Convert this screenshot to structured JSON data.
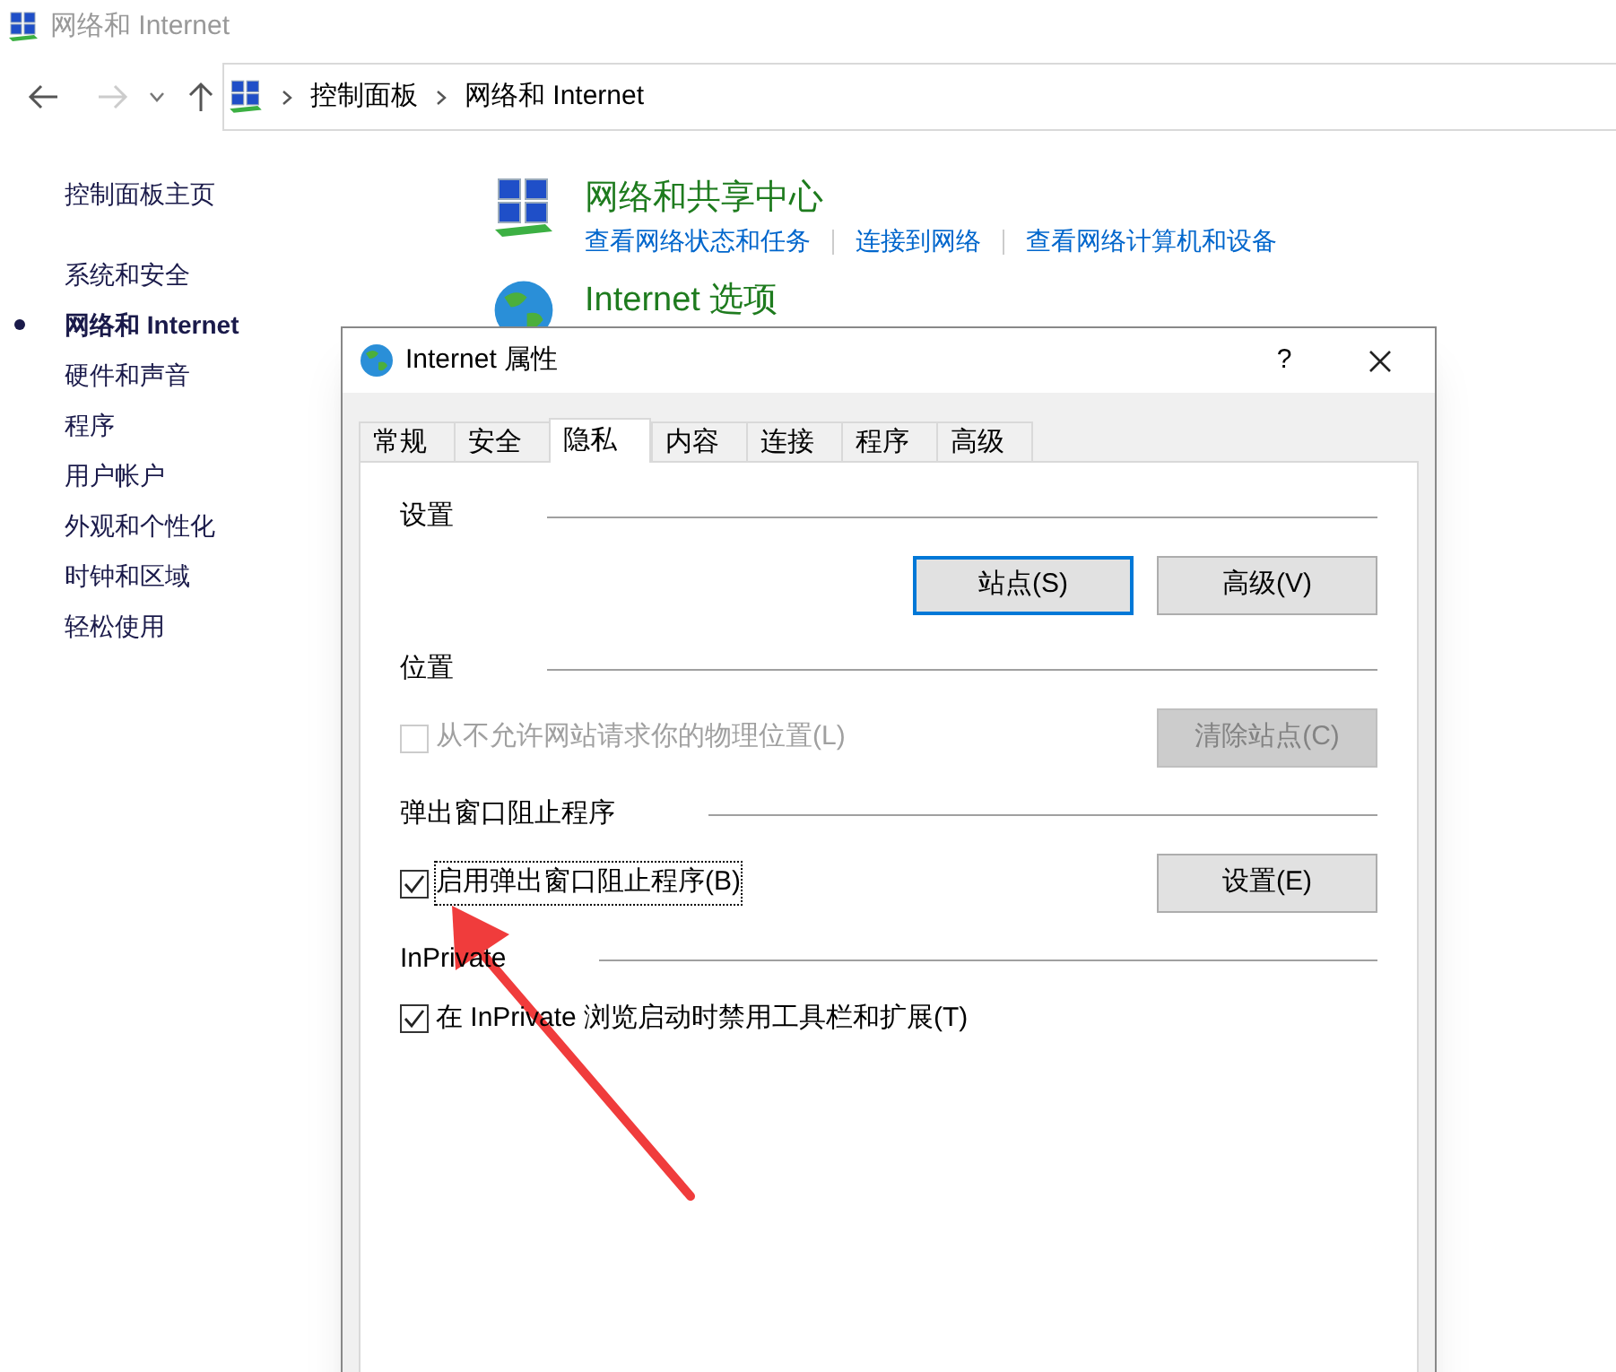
{
  "window": {
    "title": "网络和 Internet"
  },
  "breadcrumb": [
    "控制面板",
    "网络和 Internet"
  ],
  "sidebar": {
    "home": "控制面板主页",
    "items": [
      {
        "label": "系统和安全",
        "selected": false
      },
      {
        "label": "网络和 Internet",
        "selected": true
      },
      {
        "label": "硬件和声音",
        "selected": false
      },
      {
        "label": "程序",
        "selected": false
      },
      {
        "label": "用户帐户",
        "selected": false
      },
      {
        "label": "外观和个性化",
        "selected": false
      },
      {
        "label": "时钟和区域",
        "selected": false
      },
      {
        "label": "轻松使用",
        "selected": false
      }
    ]
  },
  "categories": [
    {
      "kind": "network",
      "title": "网络和共享中心",
      "links": [
        "查看网络状态和任务",
        "连接到网络",
        "查看网络计算机和设备"
      ]
    },
    {
      "kind": "globe",
      "title": "Internet 选项"
    }
  ],
  "dialog": {
    "title": "Internet 属性",
    "help": "?",
    "tabs": [
      {
        "label": "常规",
        "selected": false
      },
      {
        "label": "安全",
        "selected": false
      },
      {
        "label": "隐私",
        "selected": true
      },
      {
        "label": "内容",
        "selected": false
      },
      {
        "label": "连接",
        "selected": false
      },
      {
        "label": "程序",
        "selected": false
      },
      {
        "label": "高级",
        "selected": false
      }
    ],
    "sections": [
      {
        "heading": "设置",
        "buttons": [
          {
            "label": "站点(S)",
            "default": true,
            "disabled": false
          },
          {
            "label": "高级(V)",
            "default": false,
            "disabled": false
          }
        ]
      },
      {
        "heading": "位置",
        "checkbox": {
          "label": "从不允许网站请求你的物理位置(L)",
          "checked": false,
          "disabled": true,
          "focused": false
        },
        "buttons": [
          {
            "label": "清除站点(C)",
            "default": false,
            "disabled": true
          }
        ]
      },
      {
        "heading": "弹出窗口阻止程序",
        "checkbox": {
          "label": "启用弹出窗口阻止程序(B)",
          "checked": true,
          "disabled": false,
          "focused": true
        },
        "buttons": [
          {
            "label": "设置(E)",
            "default": false,
            "disabled": false
          }
        ]
      },
      {
        "heading": "InPrivate",
        "checkbox": {
          "label": "在 InPrivate 浏览启动时禁用工具栏和扩展(T)",
          "checked": true,
          "disabled": false,
          "focused": false
        }
      }
    ]
  }
}
